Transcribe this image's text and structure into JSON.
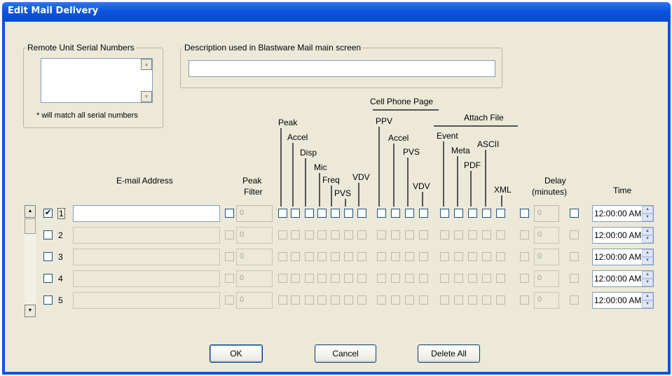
{
  "window": {
    "title": "Edit Mail Delivery"
  },
  "serial_group": {
    "title": "Remote Unit Serial Numbers",
    "note": "* will match all serial numbers",
    "value": ""
  },
  "desc_group": {
    "title": "Description used in Blastware Mail main screen",
    "value": ""
  },
  "headers": {
    "cell_phone_page": "Cell Phone Page",
    "attach_file": "Attach File",
    "email_address": "E-mail Address",
    "peak_filter_line1": "Peak",
    "peak_filter_line2": "Filter",
    "delay_line1": "Delay",
    "delay_line2": "(minutes)",
    "time": "Time",
    "peak": "Peak",
    "accel": "Accel",
    "disp": "Disp",
    "mic": "Mic",
    "freq": "Freq",
    "pvs": "PVS",
    "vdv": "VDV",
    "ppv": "PPV",
    "cp_accel": "Accel",
    "cp_pvs": "PVS",
    "cp_vdv": "VDV",
    "event": "Event",
    "meta": "Meta",
    "pdf": "PDF",
    "ascii": "ASCII",
    "xml": "XML"
  },
  "rows": [
    {
      "num": "1",
      "enabled": true,
      "email": "",
      "peak_filter": "0",
      "delay": "0",
      "time": "12:00:00 AM"
    },
    {
      "num": "2",
      "enabled": false,
      "email": "",
      "peak_filter": "0",
      "delay": "0",
      "time": "12:00:00 AM"
    },
    {
      "num": "3",
      "enabled": false,
      "email": "",
      "peak_filter": "0",
      "delay": "0",
      "time": "12:00:00 AM"
    },
    {
      "num": "4",
      "enabled": false,
      "email": "",
      "peak_filter": "0",
      "delay": "0",
      "time": "12:00:00 AM"
    },
    {
      "num": "5",
      "enabled": false,
      "email": "",
      "peak_filter": "0",
      "delay": "0",
      "time": "12:00:00 AM"
    }
  ],
  "buttons": {
    "ok": "OK",
    "cancel": "Cancel",
    "delete_all": "Delete All"
  },
  "colors": {
    "title_bar": "#0a54e3",
    "dialog_face": "#ece9d8",
    "input_border": "#7f9db9"
  }
}
